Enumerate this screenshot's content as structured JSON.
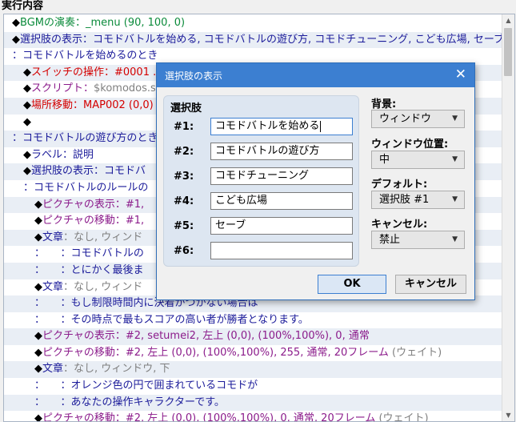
{
  "header": {
    "title": "実行内容"
  },
  "event_list": {
    "rows": [
      {
        "indent": "",
        "mark": "◆",
        "segments": [
          {
            "t": "BGMの演奏：_menu (90, 100, 0)",
            "c": "c-green"
          }
        ]
      },
      {
        "indent": "",
        "mark": "◆",
        "segments": [
          {
            "t": "選択肢の表示：コモドバトルを始める, コモドバトルの遊び方, コモドチューニング, こども広場, セーブ",
            "c": "c-navy"
          }
        ]
      },
      {
        "indent": "",
        "mark": "",
        "segments": [
          {
            "t": "：コモドバトルを始めるのとき",
            "c": "c-navy"
          }
        ]
      },
      {
        "indent": "  ",
        "mark": "◆",
        "segments": [
          {
            "t": "スイッチの操作：#0001 ...",
            "c": "c-red"
          }
        ]
      },
      {
        "indent": "  ",
        "mark": "◆",
        "segments": [
          {
            "t": "スクリプト：",
            "c": "c-purple"
          },
          {
            "t": "$komodos.s",
            "c": "c-gray"
          }
        ]
      },
      {
        "indent": "  ",
        "mark": "◆",
        "segments": [
          {
            "t": "場所移動：MAP002 (0,0)",
            "c": "c-red"
          }
        ]
      },
      {
        "indent": "  ",
        "mark": "◆",
        "segments": []
      },
      {
        "indent": "",
        "mark": "",
        "segments": [
          {
            "t": "：コモドバトルの遊び方のとき",
            "c": "c-navy"
          }
        ]
      },
      {
        "indent": "  ",
        "mark": "◆",
        "segments": [
          {
            "t": "ラベル：説明",
            "c": "c-navy"
          }
        ]
      },
      {
        "indent": "  ",
        "mark": "◆",
        "segments": [
          {
            "t": "選択肢の表示：コモドバ",
            "c": "c-navy"
          }
        ]
      },
      {
        "indent": "  ",
        "mark": "",
        "segments": [
          {
            "t": "：コモドバトルのルールの",
            "c": "c-navy"
          }
        ]
      },
      {
        "indent": "    ",
        "mark": "◆",
        "segments": [
          {
            "t": "ピクチャの表示：#1,",
            "c": "c-purple"
          }
        ]
      },
      {
        "indent": "    ",
        "mark": "◆",
        "segments": [
          {
            "t": "ピクチャの移動：#1,",
            "c": "c-purple"
          }
        ]
      },
      {
        "indent": "    ",
        "mark": "◆",
        "segments": [
          {
            "t": "文章",
            "c": "c-navy"
          },
          {
            "t": "：なし, ウィンド",
            "c": "c-gray"
          }
        ]
      },
      {
        "indent": "    ",
        "mark": "",
        "segments": [
          {
            "t": "：　　：コモドバトルの",
            "c": "c-navy"
          }
        ]
      },
      {
        "indent": "    ",
        "mark": "",
        "segments": [
          {
            "t": "：　　：とにかく最後ま",
            "c": "c-navy"
          }
        ]
      },
      {
        "indent": "    ",
        "mark": "◆",
        "segments": [
          {
            "t": "文章",
            "c": "c-navy"
          },
          {
            "t": "：なし, ウィンド",
            "c": "c-gray"
          }
        ]
      },
      {
        "indent": "    ",
        "mark": "",
        "segments": [
          {
            "t": "：　　：もし制限時間内に決着がつかない場合は",
            "c": "c-navy"
          }
        ]
      },
      {
        "indent": "    ",
        "mark": "",
        "segments": [
          {
            "t": "：　　：その時点で最もスコアの高い者が勝者となります。",
            "c": "c-navy"
          }
        ]
      },
      {
        "indent": "    ",
        "mark": "◆",
        "segments": [
          {
            "t": "ピクチャの表示：#2, setumei2, 左上 (0,0), (100%,100%), 0, 通常",
            "c": "c-purple"
          }
        ]
      },
      {
        "indent": "    ",
        "mark": "◆",
        "segments": [
          {
            "t": "ピクチャの移動：#2, 左上 (0,0), (100%,100%), 255, 通常, 20フレーム",
            "c": "c-purple"
          },
          {
            "t": " (ウェイト)",
            "c": "c-gray"
          }
        ]
      },
      {
        "indent": "    ",
        "mark": "◆",
        "segments": [
          {
            "t": "文章",
            "c": "c-navy"
          },
          {
            "t": "：なし, ウィンドウ, 下",
            "c": "c-gray"
          }
        ]
      },
      {
        "indent": "    ",
        "mark": "",
        "segments": [
          {
            "t": "：　　：オレンジ色の円で囲まれているコモドが",
            "c": "c-navy"
          }
        ]
      },
      {
        "indent": "    ",
        "mark": "",
        "segments": [
          {
            "t": "：　　：あなたの操作キャラクターです。",
            "c": "c-navy"
          }
        ]
      },
      {
        "indent": "    ",
        "mark": "◆",
        "segments": [
          {
            "t": "ピクチャの移動：#2, 左上 (0,0), (100%,100%), 0, 通常, 20フレーム",
            "c": "c-purple"
          },
          {
            "t": " (ウェイト)",
            "c": "c-gray"
          }
        ]
      }
    ]
  },
  "dialog": {
    "title": "選択肢の表示",
    "close_glyph": "✕",
    "choices_heading": "選択肢",
    "choices": [
      {
        "label": "#1:",
        "value": "コモドバトルを始める"
      },
      {
        "label": "#2:",
        "value": "コモドバトルの遊び方"
      },
      {
        "label": "#3:",
        "value": "コモドチューニング"
      },
      {
        "label": "#4:",
        "value": "こども広場"
      },
      {
        "label": "#5:",
        "value": "セーブ"
      },
      {
        "label": "#6:",
        "value": ""
      }
    ],
    "background_label": "背景:",
    "background_value": "ウィンドウ",
    "position_label": "ウィンドウ位置:",
    "position_value": "中",
    "default_label": "デフォルト:",
    "default_value": "選択肢 #1",
    "cancel_label": "キャンセル:",
    "cancel_value": "禁止",
    "ok_button": "OK",
    "cancel_button": "キャンセル"
  },
  "colors": {
    "titlebar": "#3c7fd1",
    "group_bg": "#dde6f1",
    "row_alt": "#e9eef5",
    "green": "#0a8a3a",
    "purple": "#8b1b8b",
    "red": "#d40000",
    "navy": "#1b1b9a"
  }
}
